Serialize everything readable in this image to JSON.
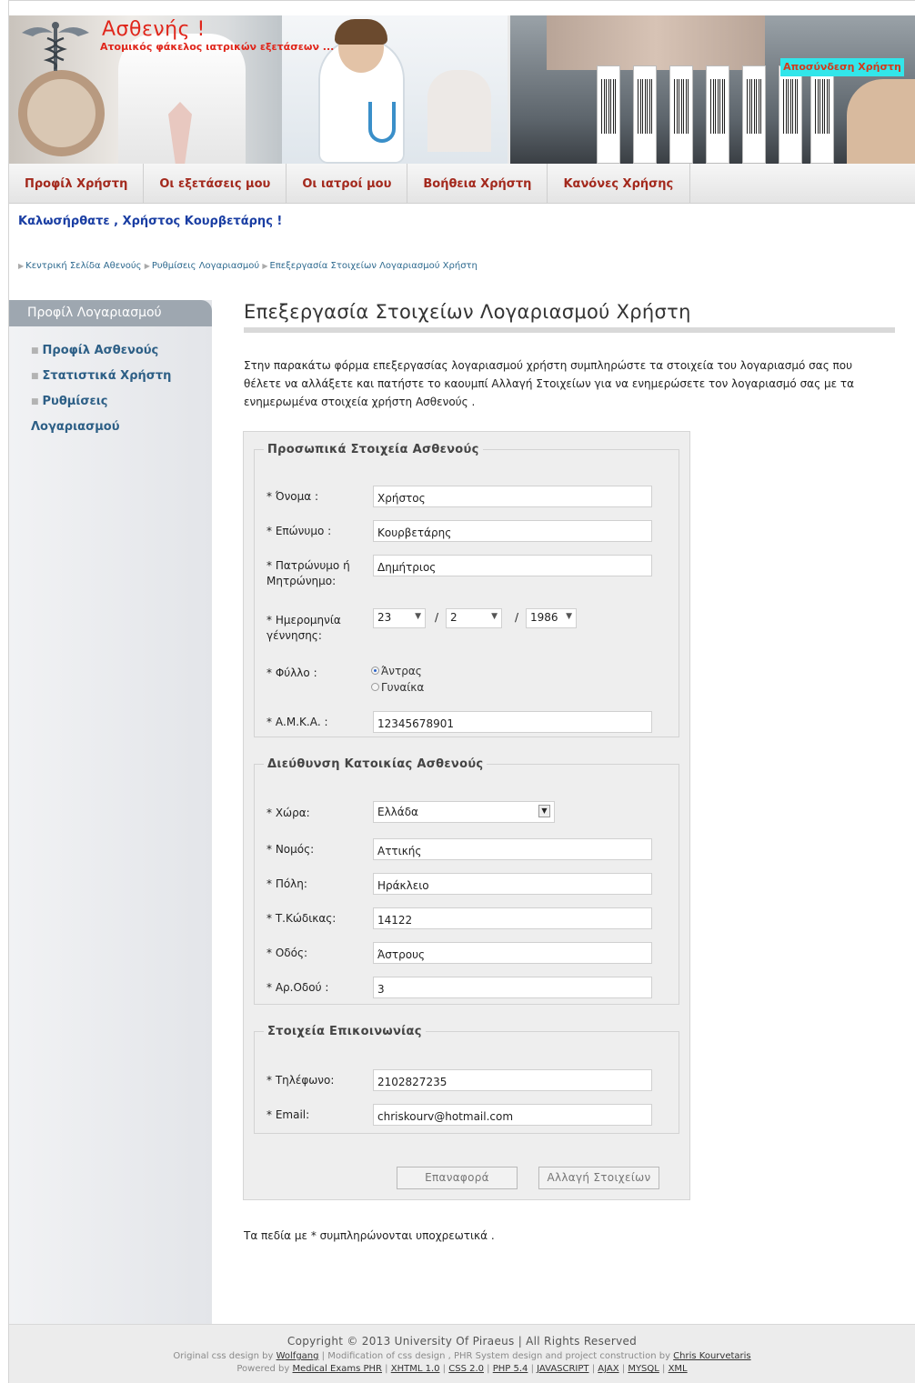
{
  "header": {
    "site_title": "Ασθενής !",
    "site_subtitle": "Ατομικός φάκελος ιατρικών εξετάσεων ...",
    "logout_label": "Αποσύνδεση Χρήστη",
    "logo_icon": "caduceus-icon"
  },
  "nav": {
    "items": [
      {
        "label": "Προφίλ Χρήστη"
      },
      {
        "label": "Οι εξετάσεις μου"
      },
      {
        "label": "Οι ιατροί μου"
      },
      {
        "label": "Βοήθεια Χρήστη"
      },
      {
        "label": "Κανόνες Χρήσης"
      }
    ]
  },
  "welcome": "Καλωσήρθατε , Χρήστος Κουρβετάρης !",
  "breadcrumb": {
    "items": [
      "Κεντρική Σελίδα Αθενούς",
      "Ρυθμίσεις Λογαριασμού",
      "Επεξεργασία Στοιχείων Λογαριασμού Χρήστη"
    ]
  },
  "sidebar": {
    "title": "Προφίλ Λογαριασμού",
    "items": [
      {
        "label": "Προφίλ Ασθενούς"
      },
      {
        "label": "Στατιστικά Χρήστη"
      },
      {
        "label": "Ρυθμίσεις Λογαριασμού"
      }
    ]
  },
  "main": {
    "title": "Επεξεργασία Στοιχείων Λογαριασμού Χρήστη",
    "intro": "Στην παρακάτω φόρμα επεξεργασίας λογαριασμού χρήστη συμπληρώστε τα στοιχεία του λογαριασμό σας που θέλετε να αλλάξετε και πατήστε το καουμπί Αλλαγή Στοιχείων για να ενημερώσετε τον λογαριασμό σας με τα ενημερωμένα στοιχεία χρήστη Ασθενούς .",
    "required_note": "Τα πεδία με * συμπληρώνονται υποχρεωτικά ."
  },
  "form": {
    "personal": {
      "legend": "Προσωπικά Στοιχεία Ασθενούς",
      "first_name_label": "* Όνομα :",
      "first_name": "Χρήστος",
      "last_name_label": "* Επώνυμο :",
      "last_name": "Κουρβετάρης",
      "parent_name_label": "* Πατρώνυμο ή Μητρώνημο:",
      "parent_name": "Δημήτριος",
      "birthdate_label": "* Ημερομηνία γέννησης:",
      "birth_day": "23",
      "birth_month": "2",
      "birth_year": "1986",
      "date_sep": "/",
      "gender_label": "* Φύλλο :",
      "gender_options": [
        "Άντρας",
        "Γυναίκα"
      ],
      "gender_selected": "Άντρας",
      "amka_label": "* Α.Μ.Κ.Α. :",
      "amka": "12345678901"
    },
    "address": {
      "legend": "Διεύθυνση Κατοικίας Ασθενούς",
      "country_label": "* Χώρα:",
      "country": "Ελλάδα",
      "prefecture_label": "* Νομός:",
      "prefecture": "Αττικής",
      "city_label": "* Πόλη:",
      "city": "Ηράκλειο",
      "postcode_label": "* Τ.Κώδικας:",
      "postcode": "14122",
      "street_label": "* Οδός:",
      "street": "Άστρους",
      "street_no_label": "* Αρ.Οδού :",
      "street_no": "3"
    },
    "contact": {
      "legend": "Στοιχεία Επικοινωνίας",
      "phone_label": "* Τηλέφωνο:",
      "phone": "2102827235",
      "email_label": "* Email:",
      "email": "chriskourv@hotmail.com"
    },
    "reset_label": "Επαναφορά",
    "submit_label": "Αλλαγή Στοιχείων"
  },
  "footer": {
    "copyright": "Copyright © 2013 University Of Piraeus | All Rights Reserved",
    "credit_prefix": "Original css design by",
    "credit_wolfgang": "Wolfgang",
    "credit_middle": "| Modification of css design , PHR System design and project construction by",
    "credit_author": "Chris Kourvetaris",
    "powered_prefix": "Powered by",
    "powered_links": [
      "Medical Exams PHR",
      "XHTML 1.0",
      "CSS 2.0",
      "PHP 5.4",
      "JAVASCRIPT",
      "AJAX",
      "MYSQL",
      "XML"
    ]
  }
}
